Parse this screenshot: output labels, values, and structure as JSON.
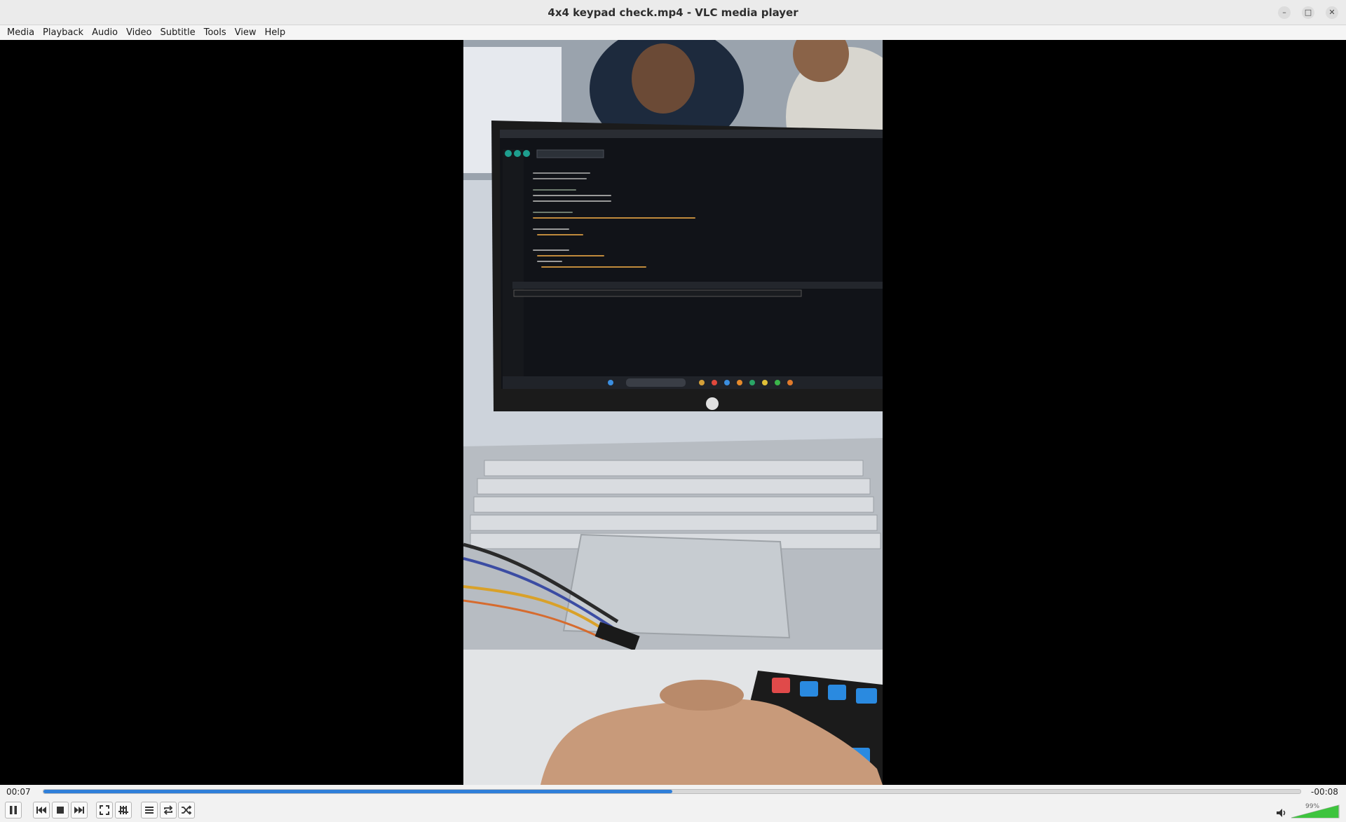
{
  "window": {
    "title": "4x4 keypad check.mp4 - VLC media player",
    "controls": [
      "minimize-icon",
      "maximize-icon",
      "close-icon"
    ]
  },
  "menubar": {
    "items": [
      {
        "label": "Media"
      },
      {
        "label": "Playback"
      },
      {
        "label": "Audio"
      },
      {
        "label": "Video"
      },
      {
        "label": "Subtitle"
      },
      {
        "label": "Tools"
      },
      {
        "label": "View"
      },
      {
        "label": "Help"
      }
    ]
  },
  "player": {
    "elapsed": "00:07",
    "remaining": "-00:08",
    "progress_fraction": 0.5,
    "volume_label": "99%",
    "volume_fraction": 0.99
  },
  "colors": {
    "accent": "#2f7fd9",
    "volume": "#3ec43e"
  }
}
